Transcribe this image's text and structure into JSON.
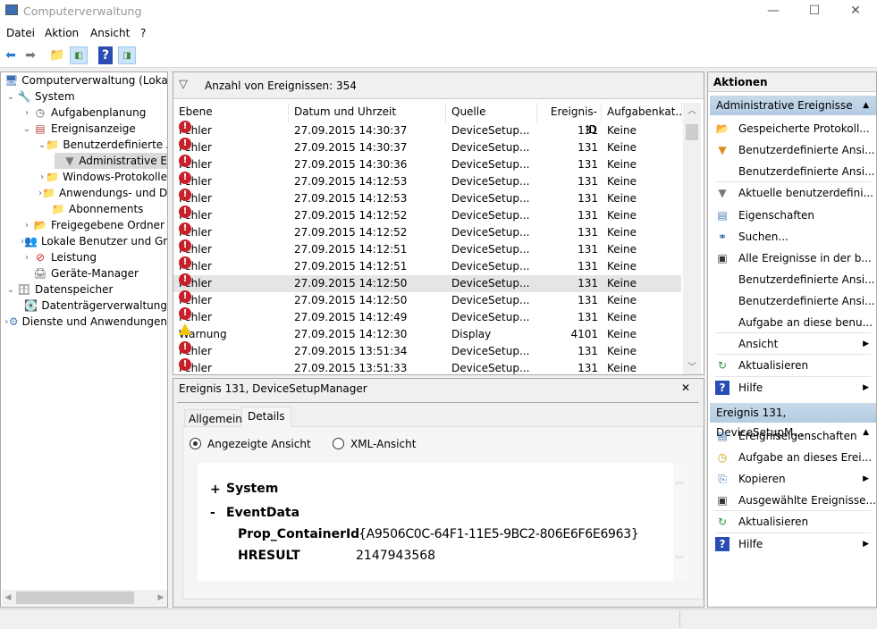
{
  "window": {
    "title": "Computerverwaltung",
    "minimize": "—",
    "maximize": "☐",
    "close": "✕"
  },
  "menu": [
    "Datei",
    "Aktion",
    "Ansicht",
    "?"
  ],
  "tree": [
    {
      "label": "Computerverwaltung (Lokal)",
      "level": 0,
      "chev": "",
      "icon": "computer-icon"
    },
    {
      "label": "System",
      "level": 0,
      "chev": "⌄",
      "icon": "tools-icon"
    },
    {
      "label": "Aufgabenplanung",
      "level": 1,
      "chev": "›",
      "icon": "clock-icon"
    },
    {
      "label": "Ereignisanzeige",
      "level": 1,
      "chev": "⌄",
      "icon": "event-viewer-icon"
    },
    {
      "label": "Benutzerdefinierte A",
      "level": 2,
      "chev": "⌄",
      "icon": "folder-filter-icon"
    },
    {
      "label": "Administrative E",
      "level": 3,
      "chev": "",
      "icon": "filter-icon",
      "selected": true
    },
    {
      "label": "Windows-Protokolle",
      "level": 2,
      "chev": "›",
      "icon": "folder-icon"
    },
    {
      "label": "Anwendungs- und D",
      "level": 2,
      "chev": "›",
      "icon": "folder-icon"
    },
    {
      "label": "Abonnements",
      "level": 2,
      "chev": "",
      "icon": "folder-icon"
    },
    {
      "label": "Freigegebene Ordner",
      "level": 1,
      "chev": "›",
      "icon": "shared-folder-icon"
    },
    {
      "label": "Lokale Benutzer und Gru",
      "level": 1,
      "chev": "›",
      "icon": "users-icon"
    },
    {
      "label": "Leistung",
      "level": 1,
      "chev": "›",
      "icon": "performance-icon"
    },
    {
      "label": "Geräte-Manager",
      "level": 1,
      "chev": "",
      "icon": "device-manager-icon"
    },
    {
      "label": "Datenspeicher",
      "level": 0,
      "chev": "⌄",
      "icon": "storage-icon"
    },
    {
      "label": "Datenträgerverwaltung",
      "level": 1,
      "chev": "",
      "icon": "disk-icon"
    },
    {
      "label": "Dienste und Anwendungen",
      "level": 0,
      "chev": "›",
      "icon": "services-icon"
    }
  ],
  "events": {
    "count_label": "Anzahl von Ereignissen: 354",
    "columns": [
      "Ebene",
      "Datum und Uhrzeit",
      "Quelle",
      "Ereignis-ID",
      "Aufgabenkat..."
    ],
    "rows": [
      [
        "Fehler",
        "27.09.2015 14:30:37",
        "DeviceSetup...",
        "131",
        "Keine"
      ],
      [
        "Fehler",
        "27.09.2015 14:30:37",
        "DeviceSetup...",
        "131",
        "Keine"
      ],
      [
        "Fehler",
        "27.09.2015 14:30:36",
        "DeviceSetup...",
        "131",
        "Keine"
      ],
      [
        "Fehler",
        "27.09.2015 14:12:53",
        "DeviceSetup...",
        "131",
        "Keine"
      ],
      [
        "Fehler",
        "27.09.2015 14:12:53",
        "DeviceSetup...",
        "131",
        "Keine"
      ],
      [
        "Fehler",
        "27.09.2015 14:12:52",
        "DeviceSetup...",
        "131",
        "Keine"
      ],
      [
        "Fehler",
        "27.09.2015 14:12:52",
        "DeviceSetup...",
        "131",
        "Keine"
      ],
      [
        "Fehler",
        "27.09.2015 14:12:51",
        "DeviceSetup...",
        "131",
        "Keine"
      ],
      [
        "Fehler",
        "27.09.2015 14:12:51",
        "DeviceSetup...",
        "131",
        "Keine"
      ],
      [
        "Fehler",
        "27.09.2015 14:12:50",
        "DeviceSetup...",
        "131",
        "Keine"
      ],
      [
        "Fehler",
        "27.09.2015 14:12:50",
        "DeviceSetup...",
        "131",
        "Keine"
      ],
      [
        "Fehler",
        "27.09.2015 14:12:49",
        "DeviceSetup...",
        "131",
        "Keine"
      ],
      [
        "Warnung",
        "27.09.2015 14:12:30",
        "Display",
        "4101",
        "Keine"
      ],
      [
        "Fehler",
        "27.09.2015 13:51:34",
        "DeviceSetup...",
        "131",
        "Keine"
      ],
      [
        "Fehler",
        "27.09.2015 13:51:33",
        "DeviceSetup...",
        "131",
        "Keine"
      ]
    ],
    "selected_index": 9
  },
  "detail": {
    "title": "Ereignis 131, DeviceSetupManager",
    "close": "✕",
    "tabs": [
      "Allgemein",
      "Details"
    ],
    "radio_friendly": "Angezeigte Ansicht",
    "radio_xml": "XML-Ansicht",
    "system_toggle": "+",
    "system_label": "System",
    "eventdata_toggle": "-",
    "eventdata_label": "EventData",
    "fields": [
      {
        "name": "Prop_ContainerId",
        "value": "{A9506C0C-64F1-11E5-9BC2-806E6F6E6963}"
      },
      {
        "name": "HRESULT",
        "value": "2147943568"
      }
    ]
  },
  "actions": {
    "header": "Aktionen",
    "section1": "Administrative Ereignisse",
    "items1": [
      {
        "label": "Gespeicherte Protokoll...",
        "icon": "open-folder-icon"
      },
      {
        "label": "Benutzerdefinierte Ansi...",
        "icon": "filter-create-icon"
      },
      {
        "label": "Benutzerdefinierte Ansi...",
        "icon": ""
      },
      {
        "label": "Aktuelle benutzerdefini...",
        "icon": "filter-icon",
        "sep": true
      },
      {
        "label": "Eigenschaften",
        "icon": "properties-icon"
      },
      {
        "label": "Suchen...",
        "icon": "binoculars-icon"
      },
      {
        "label": "Alle Ereignisse in der b...",
        "icon": "save-icon"
      },
      {
        "label": "Benutzerdefinierte Ansi...",
        "icon": ""
      },
      {
        "label": "Benutzerdefinierte Ansi...",
        "icon": ""
      },
      {
        "label": "Aufgabe an diese benu...",
        "icon": ""
      },
      {
        "label": "Ansicht",
        "icon": "",
        "sub": true,
        "sep": true
      },
      {
        "label": "Aktualisieren",
        "icon": "refresh-icon",
        "sep": true
      },
      {
        "label": "Hilfe",
        "icon": "help-icon",
        "sub": true,
        "sep": true
      }
    ],
    "section2": "Ereignis 131, DeviceSetupM...",
    "items2": [
      {
        "label": "Ereigniseigenschaften",
        "icon": "properties-icon"
      },
      {
        "label": "Aufgabe an dieses Erei...",
        "icon": "task-icon"
      },
      {
        "label": "Kopieren",
        "icon": "copy-icon",
        "sub": true
      },
      {
        "label": "Ausgewählte Ereignisse...",
        "icon": "save-icon"
      },
      {
        "label": "Aktualisieren",
        "icon": "refresh-icon",
        "sep": true
      },
      {
        "label": "Hilfe",
        "icon": "help-icon",
        "sub": true,
        "sep": true
      }
    ],
    "collapse": "▲",
    "submenu": "▶"
  }
}
